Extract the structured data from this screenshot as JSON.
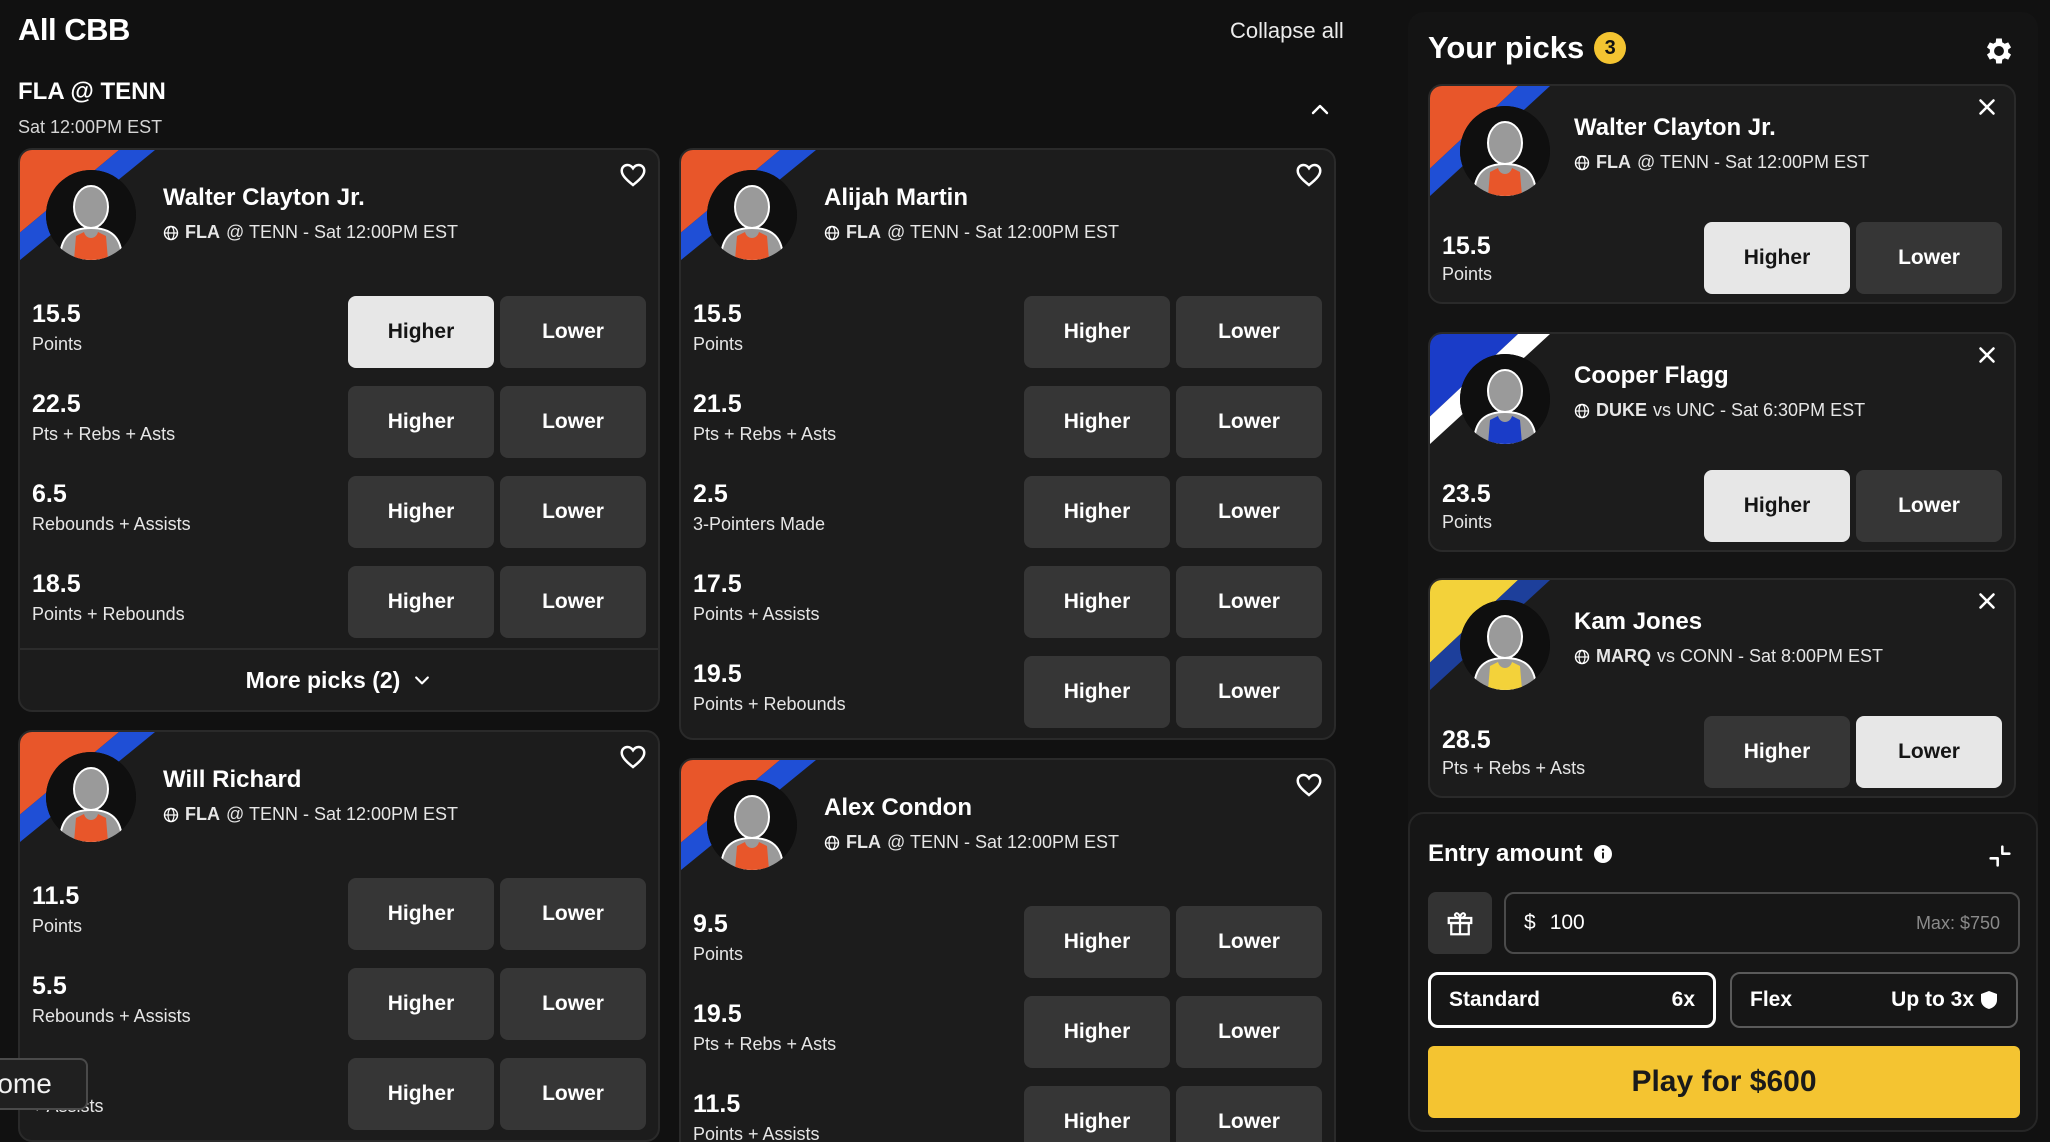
{
  "header": {
    "title": "All CBB",
    "collapse_label": "Collapse all"
  },
  "game": {
    "title": "FLA @ TENN",
    "time": "Sat 12:00PM EST"
  },
  "colors": {
    "accent_yellow": "#f4c431",
    "fla_orange": "#e8562a",
    "fla_blue": "#1f4fd6",
    "duke_blue": "#1a3cc8",
    "marq_yellow": "#f3d23a",
    "marq_blue": "#1d3f9b",
    "selected_button": "#e7e7e7",
    "button": "#363636"
  },
  "cards": [
    {
      "name": "Walter Clayton Jr.",
      "abbr": "FLA",
      "rest": "@ TENN - Sat 12:00PM EST",
      "lines": [
        {
          "value": "15.5",
          "stat": "Points",
          "higher": "Higher",
          "lower": "Lower",
          "selected": "higher"
        },
        {
          "value": "22.5",
          "stat": "Pts + Rebs + Asts",
          "higher": "Higher",
          "lower": "Lower",
          "selected": ""
        },
        {
          "value": "6.5",
          "stat": "Rebounds + Assists",
          "higher": "Higher",
          "lower": "Lower",
          "selected": ""
        },
        {
          "value": "18.5",
          "stat": "Points + Rebounds",
          "higher": "Higher",
          "lower": "Lower",
          "selected": ""
        }
      ],
      "more": "More picks (2)"
    },
    {
      "name": "Alijah Martin",
      "abbr": "FLA",
      "rest": "@ TENN - Sat 12:00PM EST",
      "lines": [
        {
          "value": "15.5",
          "stat": "Points",
          "higher": "Higher",
          "lower": "Lower",
          "selected": ""
        },
        {
          "value": "21.5",
          "stat": "Pts + Rebs + Asts",
          "higher": "Higher",
          "lower": "Lower",
          "selected": ""
        },
        {
          "value": "2.5",
          "stat": "3-Pointers Made",
          "higher": "Higher",
          "lower": "Lower",
          "selected": ""
        },
        {
          "value": "17.5",
          "stat": "Points + Assists",
          "higher": "Higher",
          "lower": "Lower",
          "selected": ""
        },
        {
          "value": "19.5",
          "stat": "Points + Rebounds",
          "higher": "Higher",
          "lower": "Lower",
          "selected": ""
        }
      ]
    },
    {
      "name": "Will Richard",
      "abbr": "FLA",
      "rest": "@ TENN - Sat 12:00PM EST",
      "lines": [
        {
          "value": "11.5",
          "stat": "Points",
          "higher": "Higher",
          "lower": "Lower",
          "selected": ""
        },
        {
          "value": "5.5",
          "stat": "Rebounds + Assists",
          "higher": "Higher",
          "lower": "Lower",
          "selected": ""
        },
        {
          "value": "",
          "stat": "+ Assists",
          "higher": "Higher",
          "lower": "Lower",
          "selected": ""
        }
      ]
    },
    {
      "name": "Alex Condon",
      "abbr": "FLA",
      "rest": "@ TENN - Sat 12:00PM EST",
      "lines": [
        {
          "value": "9.5",
          "stat": "Points",
          "higher": "Higher",
          "lower": "Lower",
          "selected": ""
        },
        {
          "value": "19.5",
          "stat": "Pts + Rebs + Asts",
          "higher": "Higher",
          "lower": "Lower",
          "selected": ""
        },
        {
          "value": "11.5",
          "stat": "Points + Assists",
          "higher": "Higher",
          "lower": "Lower",
          "selected": ""
        }
      ]
    }
  ],
  "tooltip": {
    "text": "rome"
  },
  "picks": {
    "title": "Your picks",
    "count": "3",
    "items": [
      {
        "name": "Walter Clayton Jr.",
        "abbr": "FLA",
        "rest": "@ TENN - Sat 12:00PM EST",
        "value": "15.5",
        "stat": "Points",
        "higher": "Higher",
        "lower": "Lower",
        "selected": "higher",
        "team": "fla"
      },
      {
        "name": "Cooper Flagg",
        "abbr": "DUKE",
        "rest": "vs UNC - Sat 6:30PM EST",
        "value": "23.5",
        "stat": "Points",
        "higher": "Higher",
        "lower": "Lower",
        "selected": "higher",
        "team": "duke"
      },
      {
        "name": "Kam Jones",
        "abbr": "MARQ",
        "rest": "vs CONN - Sat 8:00PM EST",
        "value": "28.5",
        "stat": "Pts + Rebs + Asts",
        "higher": "Higher",
        "lower": "Lower",
        "selected": "lower",
        "team": "marq"
      }
    ]
  },
  "entry": {
    "title": "Entry amount",
    "currency": "$",
    "amount": "100",
    "max": "Max: $750",
    "standard_label": "Standard",
    "standard_mult": "6x",
    "flex_label": "Flex",
    "flex_mult": "Up to 3x",
    "play_label": "Play for $600"
  },
  "icons": [
    "heart-icon",
    "globe-icon",
    "chevron-up-icon",
    "chevron-down-icon",
    "gear-icon",
    "close-icon",
    "info-icon",
    "shrink-icon",
    "gift-icon",
    "shield-icon",
    "avatar-silhouette"
  ]
}
